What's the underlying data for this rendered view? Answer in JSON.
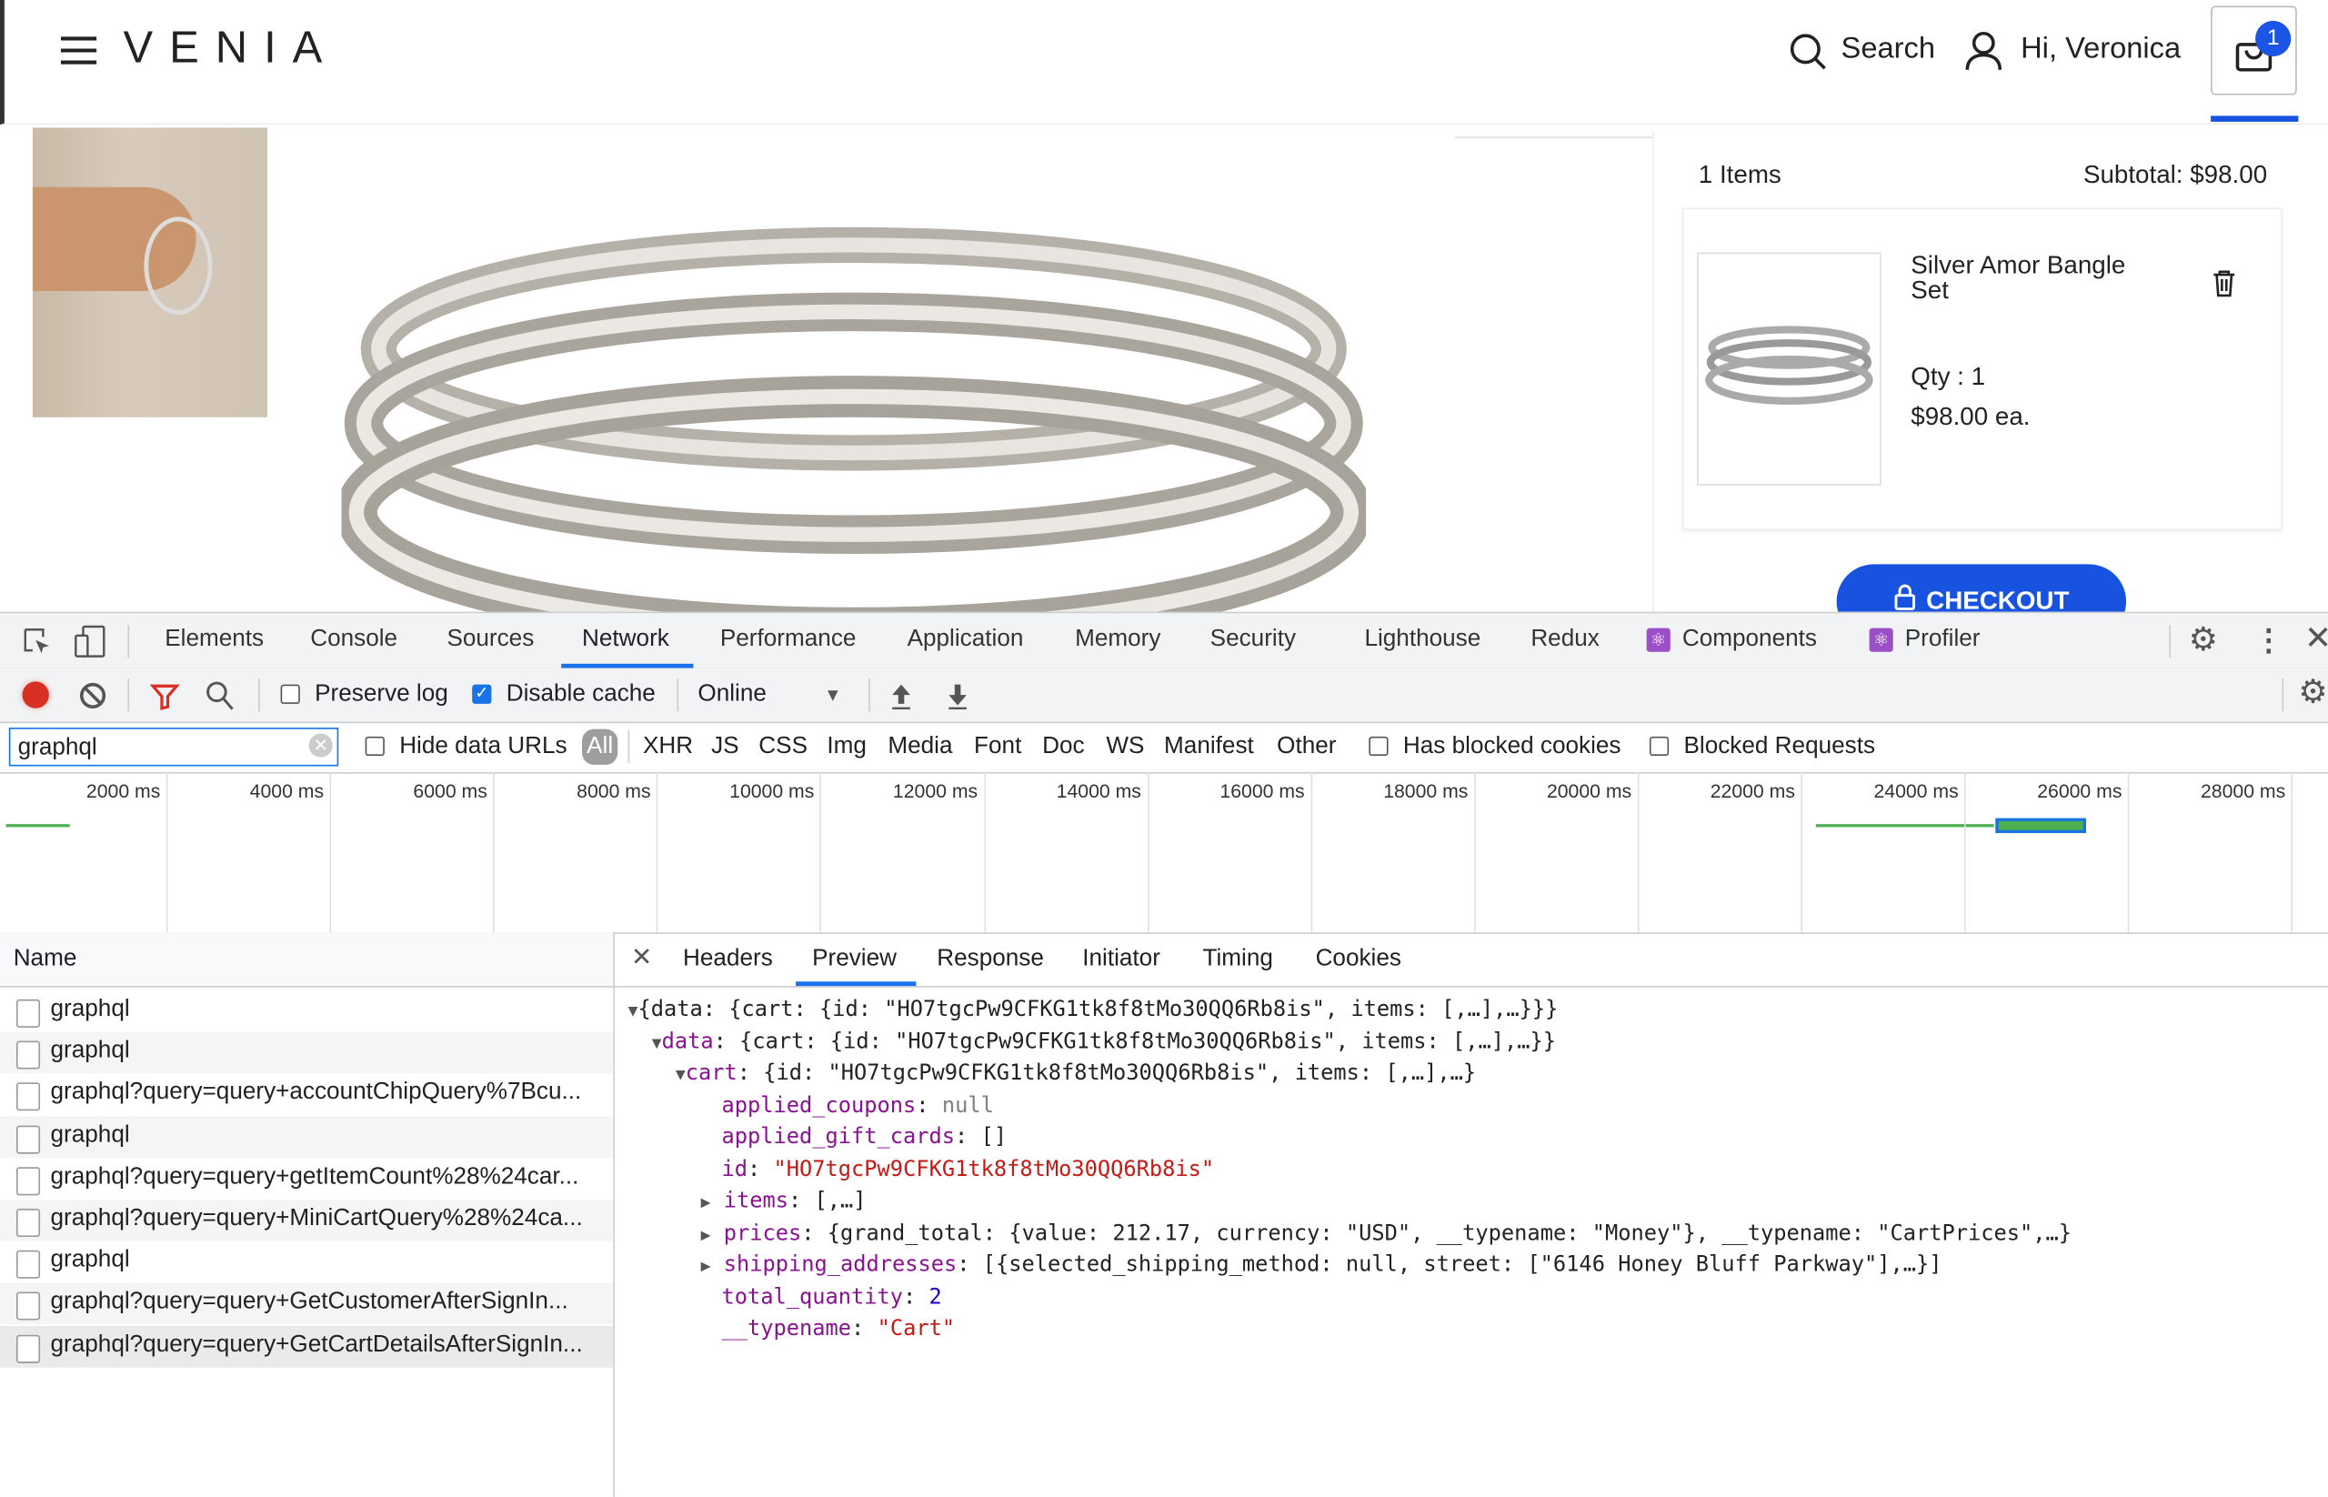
{
  "header": {
    "logo": "VENIA",
    "search_label": "Search",
    "user_label": "Hi, Veronica",
    "cart_count": "1"
  },
  "minicart": {
    "items_count": "1 Items",
    "subtotal": "Subtotal: $98.00",
    "item": {
      "name": "Silver Amor Bangle Set",
      "qty": "Qty : 1",
      "price": "$98.00 ea."
    },
    "checkout_label": "CHECKOUT"
  },
  "devtools": {
    "tabs": [
      "Elements",
      "Console",
      "Sources",
      "Network",
      "Performance",
      "Application",
      "Memory",
      "Security",
      "Lighthouse",
      "Redux",
      "Components",
      "Profiler"
    ],
    "active_tab": "Network",
    "toolbar": {
      "preserve_log": "Preserve log",
      "preserve_log_checked": false,
      "disable_cache": "Disable cache",
      "disable_cache_checked": true,
      "throttle": "Online"
    },
    "filter": {
      "value": "graphql",
      "hide_data_urls": "Hide data URLs",
      "types": [
        "All",
        "XHR",
        "JS",
        "CSS",
        "Img",
        "Media",
        "Font",
        "Doc",
        "WS",
        "Manifest",
        "Other"
      ],
      "has_blocked_cookies": "Has blocked cookies",
      "blocked_requests": "Blocked Requests"
    },
    "timeline_ticks": [
      "2000 ms",
      "4000 ms",
      "6000 ms",
      "8000 ms",
      "10000 ms",
      "12000 ms",
      "14000 ms",
      "16000 ms",
      "18000 ms",
      "20000 ms",
      "22000 ms",
      "24000 ms",
      "26000 ms",
      "28000 ms"
    ],
    "name_header": "Name",
    "requests": [
      "graphql",
      "graphql",
      "graphql?query=query+accountChipQuery%7Bcu...",
      "graphql",
      "graphql?query=query+getItemCount%28%24car...",
      "graphql?query=query+MiniCartQuery%28%24ca...",
      "graphql",
      "graphql?query=query+GetCustomerAfterSignIn...",
      "graphql?query=query+GetCartDetailsAfterSignIn..."
    ],
    "detail_tabs": [
      "Headers",
      "Preview",
      "Response",
      "Initiator",
      "Timing",
      "Cookies"
    ],
    "active_detail_tab": "Preview",
    "preview": {
      "l1": "{data: {cart: {id: \"HO7tgcPw9CFKG1tk8f8tMo30QQ6Rb8is\", items: [,…],…}}}",
      "l2k": "data",
      "l2": ": {cart: {id: \"HO7tgcPw9CFKG1tk8f8tMo30QQ6Rb8is\", items: [,…],…}}",
      "l3k": "cart",
      "l3": ": {id: \"HO7tgcPw9CFKG1tk8f8tMo30QQ6Rb8is\", items: [,…],…}",
      "l4k": "applied_coupons",
      "l4": "null",
      "l5k": "applied_gift_cards",
      "l5": "[]",
      "l6k": "id",
      "l6": "\"HO7tgcPw9CFKG1tk8f8tMo30QQ6Rb8is\"",
      "l7k": "items",
      "l7": "[,…]",
      "l8k": "prices",
      "l8": "{grand_total: {value: 212.17, currency: \"USD\", __typename: \"Money\"}, __typename: \"CartPrices\",…}",
      "l9k": "shipping_addresses",
      "l9": "[{selected_shipping_method: null, street: [\"6146 Honey Bluff Parkway\"],…}]",
      "l10k": "total_quantity",
      "l10": "2",
      "l11k": "__typename",
      "l11": "\"Cart\""
    }
  },
  "colors": {
    "accent": "#1a73e8",
    "brand": "#1853e0",
    "record": "#d93025"
  }
}
